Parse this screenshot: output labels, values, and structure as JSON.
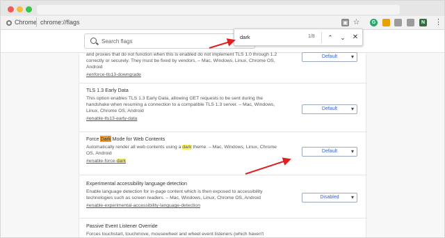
{
  "browser": {
    "omnibox": {
      "scheme_label": "Chrome",
      "url": "chrome://flags"
    },
    "icons": [
      "page-icon",
      "star-icon",
      "grammarly-extension-icon",
      "extension-icon",
      "extension-icon",
      "extension-icon",
      "extension-icon",
      "menu-icon"
    ],
    "extension_labels": [
      "G",
      "",
      "",
      "",
      "N"
    ]
  },
  "search": {
    "placeholder": "Search flags"
  },
  "find_bar": {
    "query": "dark",
    "count": "1/8"
  },
  "flags": [
    {
      "id": "tls13-downgrade",
      "title": "",
      "description_lines": [
        "and proxies that do not function when this is enabled do not implement TLS 1.0 through 1.2",
        "correctly or securely. They must be fixed by vendors. – Mac, Windows, Linux, Chrome OS,",
        "Android"
      ],
      "link": "#enforce-tls13-downgrade",
      "value": "Default"
    },
    {
      "id": "tls13-early-data",
      "title": "TLS 1.3 Early Data",
      "description_lines": [
        "This option enables TLS 1.3 Early Data, allowing GET requests to be sent during the",
        "handshake when resuming a connection to a compatible TLS 1.3 server. – Mac, Windows,",
        "Linux, Chrome OS, Android"
      ],
      "link": "#enable-tls13-early-data",
      "value": "Default"
    },
    {
      "id": "force-dark",
      "title_pre": "Force ",
      "title_match": "Dark",
      "title_post": " Mode for Web Contents",
      "desc_line1_pre": "Automatically render all web contents using a ",
      "desc_line1_match": "dark",
      "desc_line1_post": " theme. – Mac, Windows, Linux, Chrome",
      "desc_line2": "OS, Android",
      "link_pre": "#enable-force-",
      "link_match": "dark",
      "value": "Default"
    },
    {
      "id": "language-detection",
      "title": "Experimental accessibility language detection",
      "description_lines": [
        "Enable language detection for in-page content which is then exposed to accessibility",
        "technologies such as screen readers. – Mac, Windows, Linux, Chrome OS, Android"
      ],
      "link": "#enable-experimental-accessibility-language-detection",
      "value": "Disabled"
    },
    {
      "id": "passive-listener",
      "title": "Passive Event Listener Override",
      "description_lines": [
        "Forces touchstart, touchmove, mousewheel and wheel event listeners (which haven't"
      ]
    }
  ],
  "annotation_color": "#e0201f"
}
